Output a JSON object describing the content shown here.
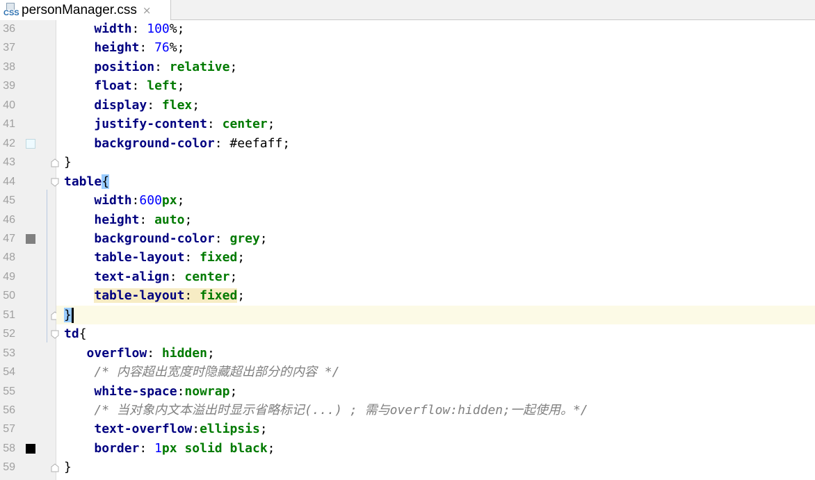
{
  "tab": {
    "icon_label": "CSS",
    "title": "personManager.css",
    "close": "×"
  },
  "lines": [
    {
      "n": "36",
      "tokens": [
        [
          "p",
          "    width"
        ],
        [
          "x",
          ": "
        ],
        [
          "n",
          "100"
        ],
        [
          "x",
          "%;"
        ]
      ]
    },
    {
      "n": "37",
      "tokens": [
        [
          "p",
          "    height"
        ],
        [
          "x",
          ": "
        ],
        [
          "n",
          "76"
        ],
        [
          "x",
          "%;"
        ]
      ]
    },
    {
      "n": "38",
      "tokens": [
        [
          "p",
          "    position"
        ],
        [
          "x",
          ": "
        ],
        [
          "v",
          "relative"
        ],
        [
          "x",
          ";"
        ]
      ]
    },
    {
      "n": "39",
      "tokens": [
        [
          "p",
          "    float"
        ],
        [
          "x",
          ": "
        ],
        [
          "v",
          "left"
        ],
        [
          "x",
          ";"
        ]
      ]
    },
    {
      "n": "40",
      "tokens": [
        [
          "p",
          "    display"
        ],
        [
          "x",
          ": "
        ],
        [
          "v",
          "flex"
        ],
        [
          "x",
          ";"
        ]
      ]
    },
    {
      "n": "41",
      "tokens": [
        [
          "p",
          "    justify-content"
        ],
        [
          "x",
          ": "
        ],
        [
          "v",
          "center"
        ],
        [
          "x",
          ";"
        ]
      ]
    },
    {
      "n": "42",
      "tokens": [
        [
          "p",
          "    background-color"
        ],
        [
          "x",
          ": #eefaff;"
        ]
      ]
    },
    {
      "n": "43",
      "tokens": [
        [
          "x",
          "}"
        ]
      ]
    },
    {
      "n": "44",
      "tokens": [
        [
          "s",
          "table"
        ],
        [
          "b",
          "{"
        ]
      ]
    },
    {
      "n": "45",
      "tokens": [
        [
          "p",
          "    width"
        ],
        [
          "x",
          ":"
        ],
        [
          "n",
          "600"
        ],
        [
          "u",
          "px"
        ],
        [
          "x",
          ";"
        ]
      ]
    },
    {
      "n": "46",
      "tokens": [
        [
          "p",
          "    height"
        ],
        [
          "x",
          ": "
        ],
        [
          "v",
          "auto"
        ],
        [
          "x",
          ";"
        ]
      ]
    },
    {
      "n": "47",
      "tokens": [
        [
          "p",
          "    background-color"
        ],
        [
          "x",
          ": "
        ],
        [
          "v",
          "grey"
        ],
        [
          "x",
          ";"
        ]
      ]
    },
    {
      "n": "48",
      "tokens": [
        [
          "p",
          "    table-layout"
        ],
        [
          "x",
          ": "
        ],
        [
          "v",
          "fixed"
        ],
        [
          "x",
          ";"
        ]
      ]
    },
    {
      "n": "49",
      "tokens": [
        [
          "p",
          "    text-align"
        ],
        [
          "x",
          ": "
        ],
        [
          "v",
          "center"
        ],
        [
          "x",
          ";"
        ]
      ]
    },
    {
      "n": "50",
      "tokens": [
        [
          "x",
          "    "
        ],
        [
          "hp",
          "table-layout"
        ],
        [
          "hx",
          ": "
        ],
        [
          "hv",
          "fixed"
        ],
        [
          "x",
          ";"
        ]
      ]
    },
    {
      "n": "51",
      "tokens": [
        [
          "b",
          "}"
        ],
        [
          "c",
          ""
        ]
      ]
    },
    {
      "n": "52",
      "tokens": [
        [
          "s",
          "td"
        ],
        [
          "x",
          "{"
        ]
      ]
    },
    {
      "n": "53",
      "tokens": [
        [
          "p",
          "   overflow"
        ],
        [
          "x",
          ": "
        ],
        [
          "v",
          "hidden"
        ],
        [
          "x",
          ";"
        ]
      ]
    },
    {
      "n": "54",
      "tokens": [
        [
          "m",
          "    /* 内容超出宽度时隐藏超出部分的内容 */"
        ]
      ]
    },
    {
      "n": "55",
      "tokens": [
        [
          "p",
          "    white-space"
        ],
        [
          "x",
          ":"
        ],
        [
          "v",
          "nowrap"
        ],
        [
          "x",
          ";"
        ]
      ]
    },
    {
      "n": "56",
      "tokens": [
        [
          "m",
          "    /* 当对象内文本溢出时显示省略标记(...) ; 需与overflow:hidden;一起使用。*/"
        ]
      ]
    },
    {
      "n": "57",
      "tokens": [
        [
          "p",
          "    text-overflow"
        ],
        [
          "x",
          ":"
        ],
        [
          "v",
          "ellipsis"
        ],
        [
          "x",
          ";"
        ]
      ]
    },
    {
      "n": "58",
      "tokens": [
        [
          "p",
          "    border"
        ],
        [
          "x",
          ": "
        ],
        [
          "n",
          "1"
        ],
        [
          "u",
          "px"
        ],
        [
          "x",
          " "
        ],
        [
          "v",
          "solid black"
        ],
        [
          "x",
          ";"
        ]
      ]
    },
    {
      "n": "59",
      "tokens": [
        [
          "x",
          "}"
        ]
      ]
    }
  ],
  "swatches": [
    {
      "line": "42",
      "color": "#eefaff"
    },
    {
      "line": "47",
      "color": "#808080"
    },
    {
      "line": "58",
      "color": "#000000"
    }
  ],
  "current_line": "51"
}
